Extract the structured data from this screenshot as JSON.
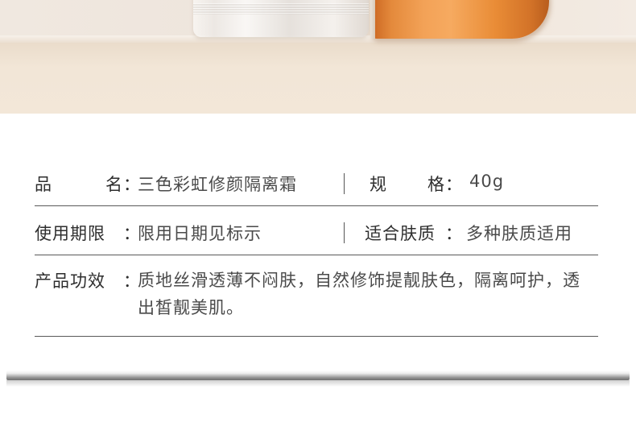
{
  "specs": {
    "name": {
      "label_chars": [
        "品",
        "名"
      ],
      "colon": "：",
      "value": "三色彩虹修颜隔离霜"
    },
    "spec": {
      "label_chars": [
        "规",
        "格"
      ],
      "colon": "：",
      "value": "40g"
    },
    "shelf_life": {
      "label": "使用期限",
      "colon": "：",
      "value": "限用日期见标示"
    },
    "skin_type": {
      "label": "适合肤质",
      "colon": "：",
      "value": "多种肤质适用"
    },
    "efficacy": {
      "label": "产品功效",
      "colon": "：",
      "value": "质地丝滑透薄不闷肤，自然修饰提靓肤色，隔离呵护，透出皙靓美肌。"
    }
  },
  "colors": {
    "text": "#333333",
    "rule": "#5a5a5a",
    "cap_orange": "#f3a257",
    "shelf_beige": "#f3e7d8"
  }
}
